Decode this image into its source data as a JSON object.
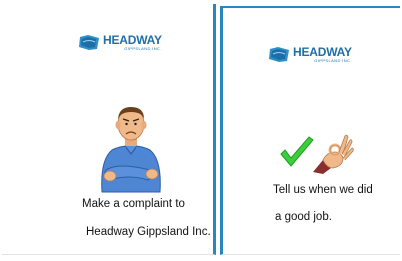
{
  "left_card": {
    "logo": {
      "brand": "HEADWAY",
      "sub": "GIPPSLAND INC."
    },
    "lines": [
      "Make a complaint to",
      "Headway Gippsland Inc."
    ]
  },
  "right_card": {
    "logo": {
      "brand": "HEADWAY",
      "sub": "GIPPSLAND INC."
    },
    "lines": [
      "Tell us when we did",
      "a good job."
    ]
  },
  "icons": {
    "left": "frowning-man-arms-crossed-icon",
    "right_1": "green-check-mark-icon",
    "right_2": "ok-hand-gesture-icon"
  },
  "colors": {
    "panel_border": "#2a86be",
    "brand": "#1f6fa8",
    "check": "#3ccf3c",
    "shirt": "#4f86d3",
    "skin": "#f0b98a",
    "sleeve": "#8b2e2e"
  }
}
